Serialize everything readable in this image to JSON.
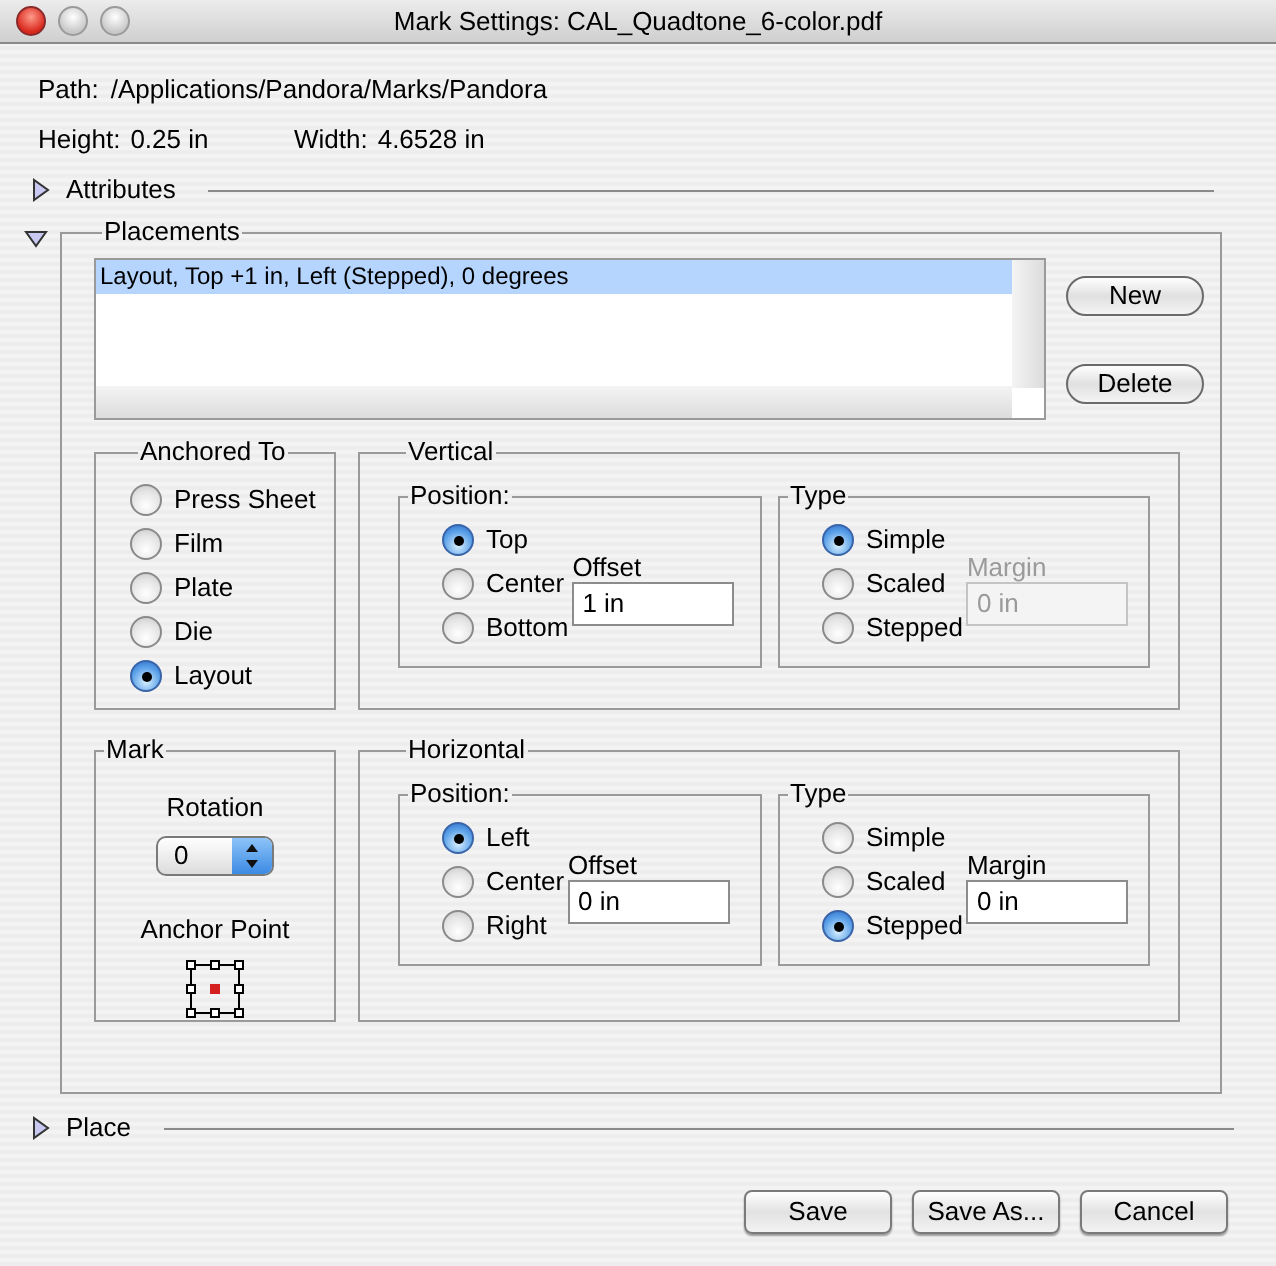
{
  "window": {
    "title": "Mark Settings: CAL_Quadtone_6-color.pdf"
  },
  "path": {
    "label": "Path:",
    "value": "/Applications/Pandora/Marks/Pandora"
  },
  "size": [
    {
      "label": "Height:",
      "value": "0.25 in"
    },
    {
      "label": "Width:",
      "value": "4.6528 in"
    }
  ],
  "attributes": {
    "label": "Attributes",
    "expanded": false
  },
  "placements": {
    "label": "Placements",
    "expanded": true,
    "list": [
      {
        "text": "Layout, Top +1 in, Left (Stepped), 0 degrees",
        "selected": true
      }
    ],
    "list_buttons": [
      "New",
      "Delete"
    ],
    "anchored_to": {
      "title": "Anchored To",
      "options": [
        {
          "label": "Press Sheet",
          "selected": false
        },
        {
          "label": "Film",
          "selected": false
        },
        {
          "label": "Plate",
          "selected": false
        },
        {
          "label": "Die",
          "selected": false
        },
        {
          "label": "Layout",
          "selected": true
        }
      ]
    },
    "vertical": {
      "title": "Vertical",
      "position": {
        "title": "Position:",
        "options": [
          {
            "label": "Top",
            "selected": true
          },
          {
            "label": "Center",
            "selected": false
          },
          {
            "label": "Bottom",
            "selected": false
          }
        ],
        "field": {
          "label": "Offset",
          "value": "1 in",
          "disabled": false
        }
      },
      "type": {
        "title": "Type",
        "options": [
          {
            "label": "Simple",
            "selected": true
          },
          {
            "label": "Scaled",
            "selected": false
          },
          {
            "label": "Stepped",
            "selected": false
          }
        ],
        "field": {
          "label": "Margin",
          "value": "0 in",
          "disabled": true
        }
      }
    },
    "mark": {
      "title": "Mark",
      "rotation": {
        "label": "Rotation",
        "value": "0"
      },
      "anchor_point": {
        "label": "Anchor Point"
      }
    },
    "horizontal": {
      "title": "Horizontal",
      "position": {
        "title": "Position:",
        "options": [
          {
            "label": "Left",
            "selected": true
          },
          {
            "label": "Center",
            "selected": false
          },
          {
            "label": "Right",
            "selected": false
          }
        ],
        "field": {
          "label": "Offset",
          "value": "0 in",
          "disabled": false
        }
      },
      "type": {
        "title": "Type",
        "options": [
          {
            "label": "Simple",
            "selected": false
          },
          {
            "label": "Scaled",
            "selected": false
          },
          {
            "label": "Stepped",
            "selected": true
          }
        ],
        "field": {
          "label": "Margin",
          "value": "0 in",
          "disabled": false
        }
      }
    }
  },
  "place": {
    "label": "Place",
    "expanded": false
  },
  "buttons": [
    "Save",
    "Save As...",
    "Cancel"
  ]
}
